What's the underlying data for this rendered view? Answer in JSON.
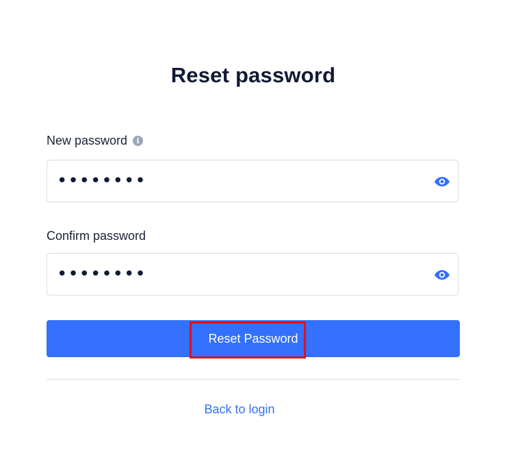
{
  "form": {
    "title": "Reset password",
    "new_password": {
      "label": "New password",
      "value": "••••••••"
    },
    "confirm_password": {
      "label": "Confirm password",
      "value": "••••••••"
    },
    "submit_label": "Reset Password",
    "back_link_label": "Back to login"
  },
  "icons": {
    "info": "info-icon",
    "show_password": "eye-icon"
  },
  "colors": {
    "primary": "#3370fb",
    "highlight": "#e0101a",
    "title_text": "#111a33",
    "info_icon": "#9aa5b8"
  }
}
